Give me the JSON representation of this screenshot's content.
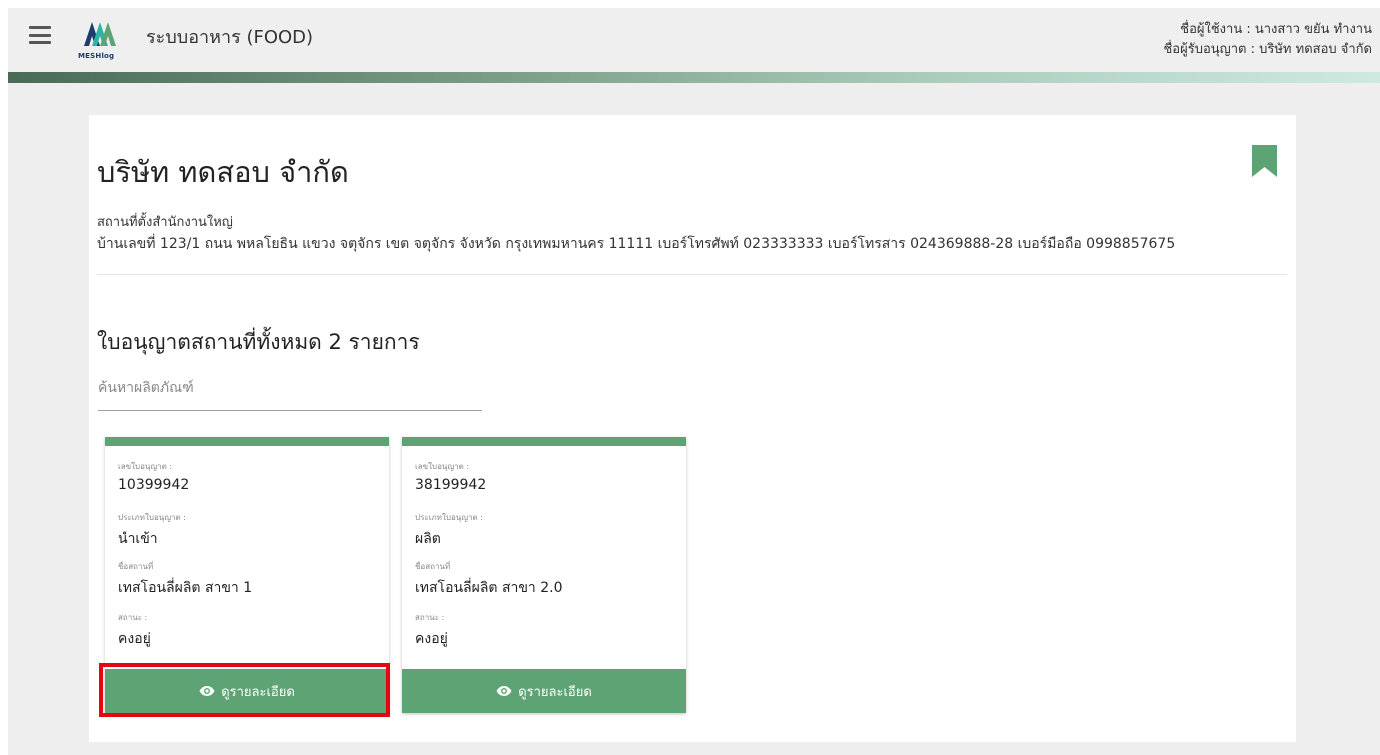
{
  "header": {
    "logo_text": "MESHlog",
    "app_title": "ระบบอาหาร (FOOD)",
    "user_line": "ชื่อผู้ใช้งาน : นางสาว ขยัน ทำงาน",
    "licensee_line": "ชื่อผู้รับอนุญาต : บริษัท ทดสอบ จำกัด"
  },
  "company": {
    "name": "บริษัท ทดสอบ จำกัด",
    "hq_label": "สถานที่ตั้งสำนักงานใหญ่",
    "hq_address": "บ้านเลขที่ 123/1 ถนน พหลโยธิน แขวง จตุจักร เขต จตุจักร จังหวัด กรุงเทพมหานคร 11111 เบอร์โทรศัพท์ 023333333 เบอร์โทรสาร 024369888-28 เบอร์มือถือ 0998857675"
  },
  "licenses": {
    "heading": "ใบอนุญาตสถานที่ทั้งหมด 2 รายการ",
    "search_placeholder": "ค้นหาผลิตภัณฑ์",
    "labels": {
      "license_no": "เลขใบอนุญาต :",
      "license_type": "ประเภทใบอนุญาต :",
      "place_name": "ชื่อสถานที่",
      "status": "สถานะ :",
      "detail_button": "ดูรายละเอียด"
    },
    "items": [
      {
        "license_no": "10399942",
        "license_type": "นำเข้า",
        "place_name": "เทสโอนลี่ผลิต สาขา 1",
        "status": "คงอยู่"
      },
      {
        "license_no": "38199942",
        "license_type": "ผลิต",
        "place_name": "เทสโอนลี่ผลิต สาขา 2.0",
        "status": "คงอยู่"
      }
    ]
  },
  "colors": {
    "accent_green": "#5da373",
    "highlight_red": "#e30613",
    "logo_teal": "#2bb3a3",
    "logo_dark": "#1d3b6b"
  }
}
